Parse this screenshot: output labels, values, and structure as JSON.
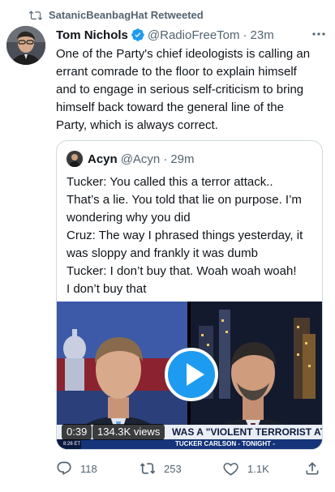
{
  "social_context": {
    "text": "SatanicBeanbagHat Retweeted",
    "icon": "retweet-icon"
  },
  "tweet": {
    "author": {
      "name": "Tom Nichols",
      "handle": "@RadioFreeTom",
      "verified": true,
      "avatar": "avatar-photo"
    },
    "separator": "·",
    "time": "23m",
    "more_icon": "more-icon",
    "text_lines": [
      "One of the Party's chief ideologists is calling an",
      "errant comrade to the floor to explain himself",
      "and to engage in serious self-criticism to bring",
      "himself back toward the general line of the",
      "Party, which is always correct."
    ]
  },
  "quote": {
    "author": {
      "name": "Acyn",
      "handle": "@Acyn",
      "avatar": "avatar-photo"
    },
    "separator": "·",
    "time": "29m",
    "text_lines": [
      "Tucker: You called this a terror attack..",
      "That’s a lie. You told that lie on purpose. I’m",
      "wondering why you did",
      "Cruz: The way I phrased things yesterday, it",
      "was sloppy and frankly it was dumb",
      "Tucker: I don’t buy that. Woah woah woah!",
      "I don’t buy that"
    ],
    "video": {
      "duration": "0:39",
      "views": "134.3K views",
      "chyron": "WAS A \"VIOLENT TERRORIST ATTACK\"",
      "show_tag": "TUCKER CARLSON - TONIGHT -",
      "clock": "8:26 ET",
      "play_icon": "play-icon"
    }
  },
  "actions": {
    "reply": {
      "icon": "reply-icon",
      "count": "118"
    },
    "retweet": {
      "icon": "retweet-icon",
      "count": "253"
    },
    "like": {
      "icon": "heart-icon",
      "count": "1.1K"
    },
    "share": {
      "icon": "share-icon"
    }
  },
  "colors": {
    "text": "#0f1419",
    "secondary": "#536471",
    "accent": "#1d9bf0",
    "border": "#cfd9de"
  }
}
